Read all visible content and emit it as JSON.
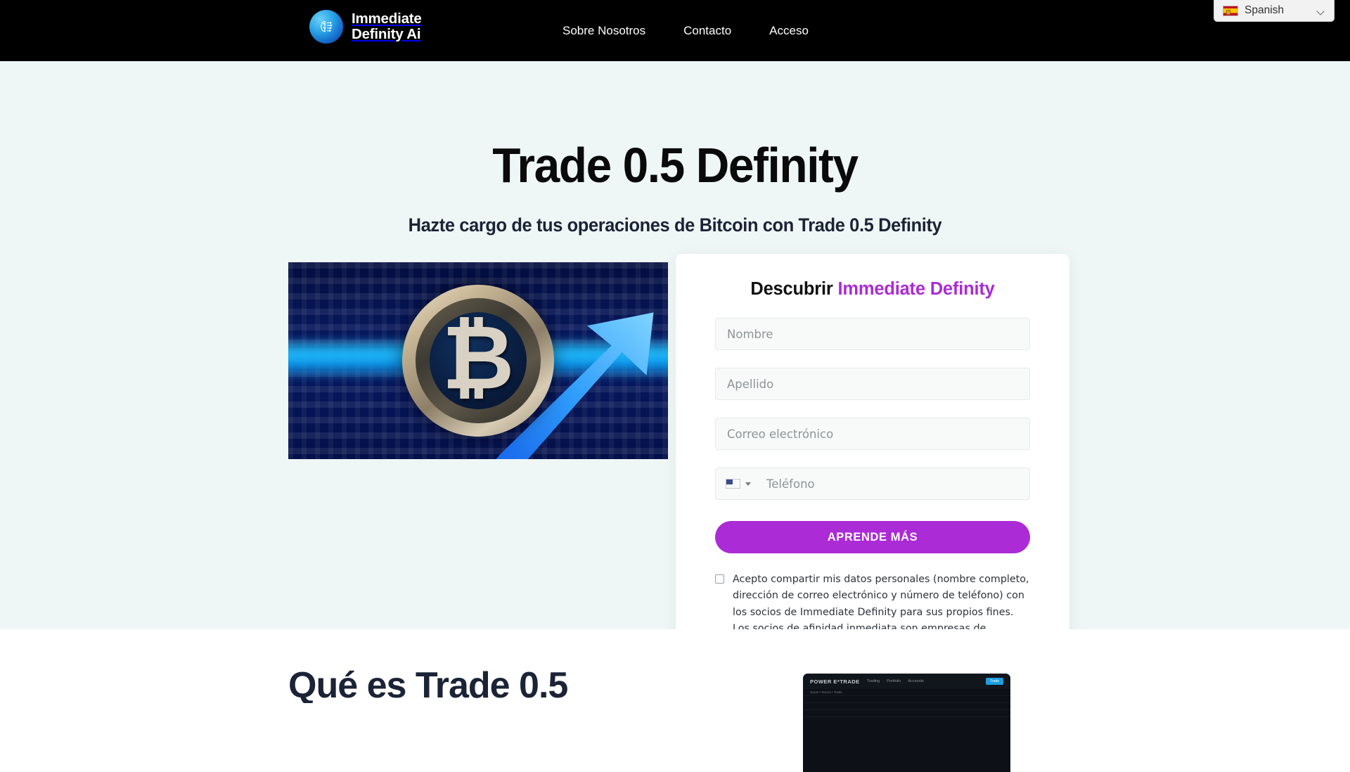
{
  "header": {
    "logo": {
      "icon": "brain-circuit-icon",
      "line1": "Immediate",
      "line2": "Definity Ai"
    },
    "nav": [
      {
        "label": "Sobre Nosotros"
      },
      {
        "label": "Contacto"
      },
      {
        "label": "Acceso"
      }
    ],
    "language_switcher": {
      "flag_icon": "spain-flag-icon",
      "label": "Spanish",
      "chevron_icon": "chevron-down-icon"
    }
  },
  "hero": {
    "title": "Trade 0.5 Definity",
    "subtitle": "Hazte cargo de tus operaciones de Bitcoin con Trade 0.5 Definity",
    "image_alt": "bitcoin-coin-rising-arrow-image"
  },
  "form": {
    "title_plain": "Descubrir",
    "title_accent": "Immediate Definity",
    "accent_color": "#ab2bd6",
    "fields": [
      {
        "name": "first-name",
        "placeholder": "Nombre",
        "value": ""
      },
      {
        "name": "last-name",
        "placeholder": "Apellido",
        "value": ""
      },
      {
        "name": "email",
        "placeholder": "Correo electrónico",
        "value": ""
      }
    ],
    "phone": {
      "placeholder": "Teléfono",
      "value": "",
      "country_flag_icon": "usa-flag-icon",
      "caret_icon": "caret-down-icon"
    },
    "submit_label": "APRENDE MÁS",
    "consent": {
      "checked": false,
      "text": "Acepto compartir mis datos personales (nombre completo, dirección de correo electrónico y número de teléfono) con los socios de Immediate Definity para sus propios fines. Los socios de afinidad inmediata son empresas de educación en inversiones."
    }
  },
  "lower_section": {
    "title": "Qué es Trade 0.5",
    "screenshot": {
      "brand": "POWER E*TRADE",
      "tabs": [
        "Trading",
        "Portfolio",
        "Accounts"
      ],
      "action_label": "Trade",
      "rows": [
        "Quote  •  Stocks  •  Totals"
      ]
    }
  },
  "colors": {
    "header_bg": "#000000",
    "hero_bg": "#eff7f6",
    "card_bg": "#ffffff",
    "accent_purple": "#ab2bd6",
    "heading_navy": "#1b2336"
  }
}
